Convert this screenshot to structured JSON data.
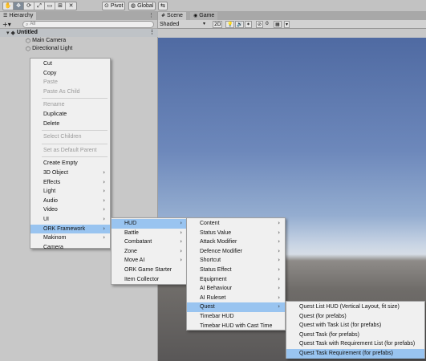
{
  "toolbar": {
    "tools": [
      {
        "name": "hand-tool-icon",
        "glyph": "✋"
      },
      {
        "name": "move-tool-icon",
        "glyph": "✥"
      },
      {
        "name": "rotate-tool-icon",
        "glyph": "⟳"
      },
      {
        "name": "scale-tool-icon",
        "glyph": "⤢"
      },
      {
        "name": "rect-tool-icon",
        "glyph": "▭"
      },
      {
        "name": "transform-tool-icon",
        "glyph": "⊞"
      },
      {
        "name": "custom-tool-icon",
        "glyph": "✕"
      }
    ],
    "pivot_label": "Pivot",
    "global_label": "Global",
    "collab_icon": "⇆"
  },
  "hierarchy": {
    "tab_label": "Hierarchy",
    "search_placeholder": "All",
    "add_label": "+▾",
    "items": [
      "Untitled",
      "Main Camera",
      "Directional Light"
    ]
  },
  "scene": {
    "tabs": [
      "Scene",
      "Game"
    ],
    "shading": "Shaded",
    "mode_2d": "2D",
    "gizmo_count": "0"
  },
  "context_menu": {
    "groups": [
      [
        {
          "label": "Cut"
        },
        {
          "label": "Copy"
        },
        {
          "label": "Paste",
          "disabled": true
        },
        {
          "label": "Paste As Child",
          "disabled": true
        }
      ],
      [
        {
          "label": "Rename",
          "disabled": true
        },
        {
          "label": "Duplicate"
        },
        {
          "label": "Delete"
        }
      ],
      [
        {
          "label": "Select Children",
          "disabled": true
        }
      ],
      [
        {
          "label": "Set as Default Parent",
          "disabled": true
        }
      ],
      [
        {
          "label": "Create Empty"
        },
        {
          "label": "3D Object",
          "sub": true
        },
        {
          "label": "Effects",
          "sub": true
        },
        {
          "label": "Light",
          "sub": true
        },
        {
          "label": "Audio",
          "sub": true
        },
        {
          "label": "Video",
          "sub": true
        },
        {
          "label": "UI",
          "sub": true
        },
        {
          "label": "ORK Framework",
          "sub": true,
          "hl": true
        },
        {
          "label": "Makinom",
          "sub": true
        },
        {
          "label": "Camera"
        }
      ]
    ]
  },
  "ork_menu": {
    "items": [
      {
        "label": "HUD",
        "sub": true,
        "hl": true
      },
      {
        "label": "Battle",
        "sub": true
      },
      {
        "label": "Combatant",
        "sub": true
      },
      {
        "label": "Zone",
        "sub": true
      },
      {
        "label": "Move AI",
        "sub": true
      },
      {
        "label": "ORK Game Starter"
      },
      {
        "label": "Item Collector"
      }
    ]
  },
  "hud_menu": {
    "items": [
      {
        "label": "Content",
        "sub": true
      },
      {
        "label": "Status Value",
        "sub": true
      },
      {
        "label": "Attack Modifier",
        "sub": true
      },
      {
        "label": "Defence Modifier",
        "sub": true
      },
      {
        "label": "Shortcut",
        "sub": true
      },
      {
        "label": "Status Effect",
        "sub": true
      },
      {
        "label": "Equipment",
        "sub": true
      },
      {
        "label": "AI Behaviour",
        "sub": true
      },
      {
        "label": "AI Ruleset",
        "sub": true
      },
      {
        "label": "Quest",
        "sub": true,
        "hl": true
      },
      {
        "label": "Timebar HUD"
      },
      {
        "label": "Timebar HUD with Cast Time"
      }
    ]
  },
  "quest_menu": {
    "items": [
      {
        "label": "Quest List HUD (Vertical Layout, fit size)"
      },
      {
        "label": "Quest (for prefabs)"
      },
      {
        "label": "Quest with Task List (for prefabs)"
      },
      {
        "label": "Quest Task (for prefabs)"
      },
      {
        "label": "Quest Task with Requirement List (for prefabs)"
      },
      {
        "label": "Quest Task Requirement (for prefabs)",
        "hl": true
      }
    ]
  }
}
